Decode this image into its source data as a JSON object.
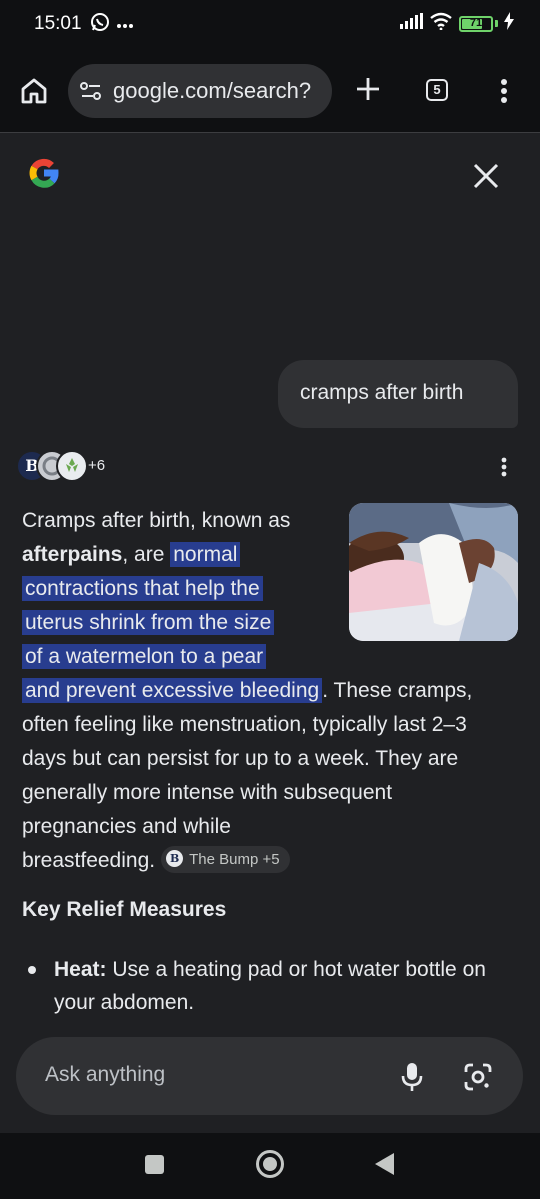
{
  "status_bar": {
    "time": "15:01",
    "battery_level": "71",
    "battery_fraction": 0.71,
    "icons": [
      "whatsapp-icon",
      "more-notifications-icon",
      "signal-icon",
      "wifi-icon",
      "battery-icon",
      "charging-icon"
    ]
  },
  "browser": {
    "url": "google.com/search?",
    "tab_count": "5"
  },
  "query": "cramps after birth",
  "sources": {
    "avatar_letter": "B",
    "more_count": "+6"
  },
  "answer": {
    "line1": "Cramps after birth, known as",
    "line2_bold": "afterpains",
    "line2_rest": ", are ",
    "hl1": "normal",
    "hl2": "contractions that help the",
    "hl3": "uterus shrink from the size",
    "hl4": "of a watermelon to a pear",
    "hl5": "and prevent excessive bleeding",
    "line6_rest": ". These cramps,",
    "line7": "often feeling like menstruation, typically last 2–3",
    "line8": "days but can persist for up to a week. They are",
    "line9": "generally more intense with subsequent",
    "line10": "pregnancies and while",
    "line11": "breastfeeding.",
    "citation": {
      "letter": "B",
      "label": "The Bump +5"
    }
  },
  "section": {
    "title": "Key Relief Measures",
    "bullets": [
      {
        "label": "Heat:",
        "text": " Use a heating pad or hot water bottle on your abdomen."
      }
    ]
  },
  "ask_bar": {
    "placeholder": "Ask anything"
  },
  "colors": {
    "background": "#1f2023",
    "highlight": "#283d8f",
    "surface": "#303134",
    "battery_green": "#6fd36a"
  }
}
